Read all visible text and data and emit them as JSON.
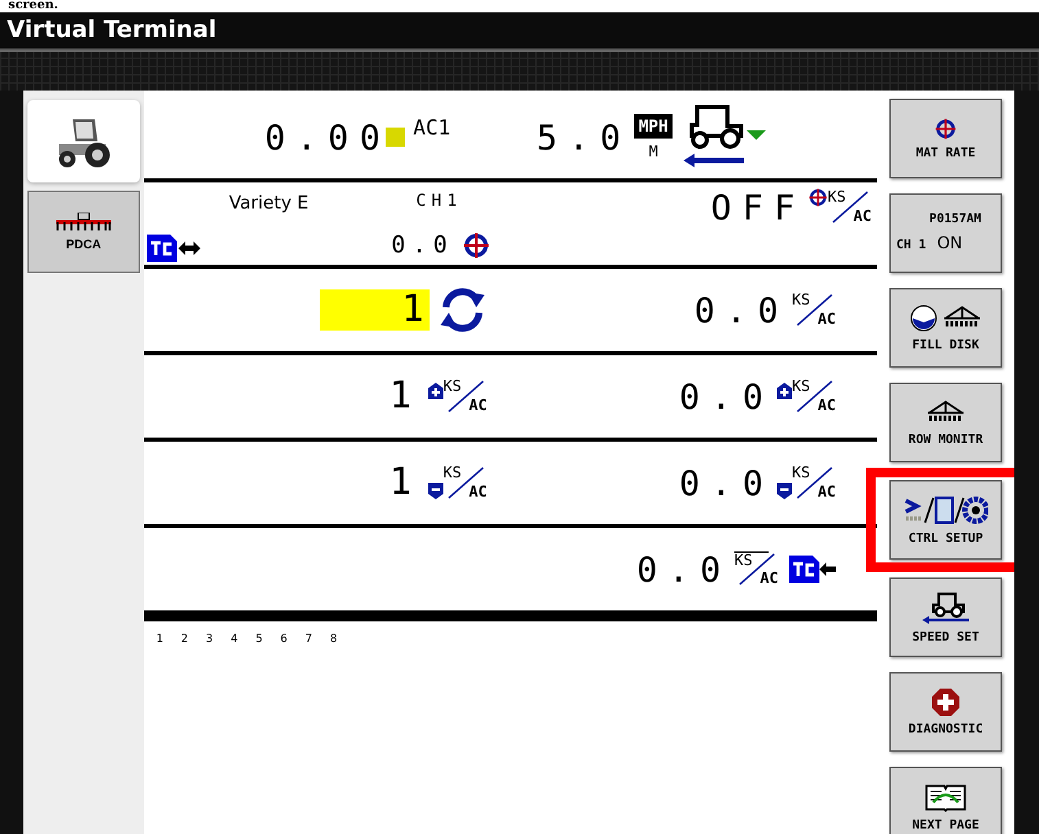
{
  "caption": "screen.",
  "window": {
    "title": "Virtual Terminal"
  },
  "side_tabs": [
    {
      "kind": "tractor",
      "selected": true
    },
    {
      "kind": "planter",
      "label": "PDCA",
      "selected": false
    }
  ],
  "header": {
    "area": "0.00",
    "area_unit": "AC1",
    "speed": "5.0",
    "speed_unit": "MPH",
    "speed_source": "M"
  },
  "product": {
    "name": "Variety E",
    "channel": "CH1",
    "rate": "0.0",
    "status": "OFF",
    "unit": {
      "top": "KS",
      "bottom": "AC",
      "kind": "target",
      "overline": false
    }
  },
  "rows": [
    {
      "left": {
        "kind": "cycle",
        "value": "1",
        "highlighted": true
      },
      "right": {
        "value": "0.0",
        "tc_link": false,
        "unit": {
          "top": "KS",
          "bottom": "AC",
          "kind": "plain",
          "overline": false
        }
      }
    },
    {
      "left": {
        "kind": "unit",
        "value": "1",
        "highlighted": false,
        "unit": {
          "top": "KS",
          "bottom": "AC",
          "kind": "up",
          "overline": false
        }
      },
      "right": {
        "value": "0.0",
        "tc_link": false,
        "unit": {
          "top": "KS",
          "bottom": "AC",
          "kind": "up",
          "overline": false
        }
      }
    },
    {
      "left": {
        "kind": "unit",
        "value": "1",
        "highlighted": false,
        "unit": {
          "top": "KS",
          "bottom": "AC",
          "kind": "down",
          "overline": false
        }
      },
      "right": {
        "value": "0.0",
        "tc_link": false,
        "unit": {
          "top": "KS",
          "bottom": "AC",
          "kind": "down",
          "overline": false
        }
      }
    },
    {
      "left": {
        "kind": "empty"
      },
      "right": {
        "value": "0.0",
        "tc_link": true,
        "unit": {
          "top": "KS",
          "bottom": "AC",
          "kind": "plain",
          "overline": true
        }
      }
    }
  ],
  "page_numbers": [
    "1",
    "2",
    "3",
    "4",
    "5",
    "6",
    "7",
    "8"
  ],
  "softkeys": [
    {
      "kind": "target",
      "label": "MAT RATE",
      "highlighted": false
    },
    {
      "kind": "channel",
      "label": "P0157AM",
      "channel": "CH 1",
      "state": "ON",
      "highlighted": false
    },
    {
      "kind": "fill",
      "label": "FILL DISK",
      "highlighted": false
    },
    {
      "kind": "row",
      "label": "ROW MONITR",
      "highlighted": false
    },
    {
      "kind": "setup",
      "label": "CTRL SETUP",
      "highlighted": true
    },
    {
      "kind": "speed",
      "label": "SPEED SET",
      "highlighted": false
    },
    {
      "kind": "diag",
      "label": "DIAGNOSTIC",
      "highlighted": false
    },
    {
      "kind": "book",
      "label": "NEXT PAGE",
      "highlighted": false
    }
  ]
}
